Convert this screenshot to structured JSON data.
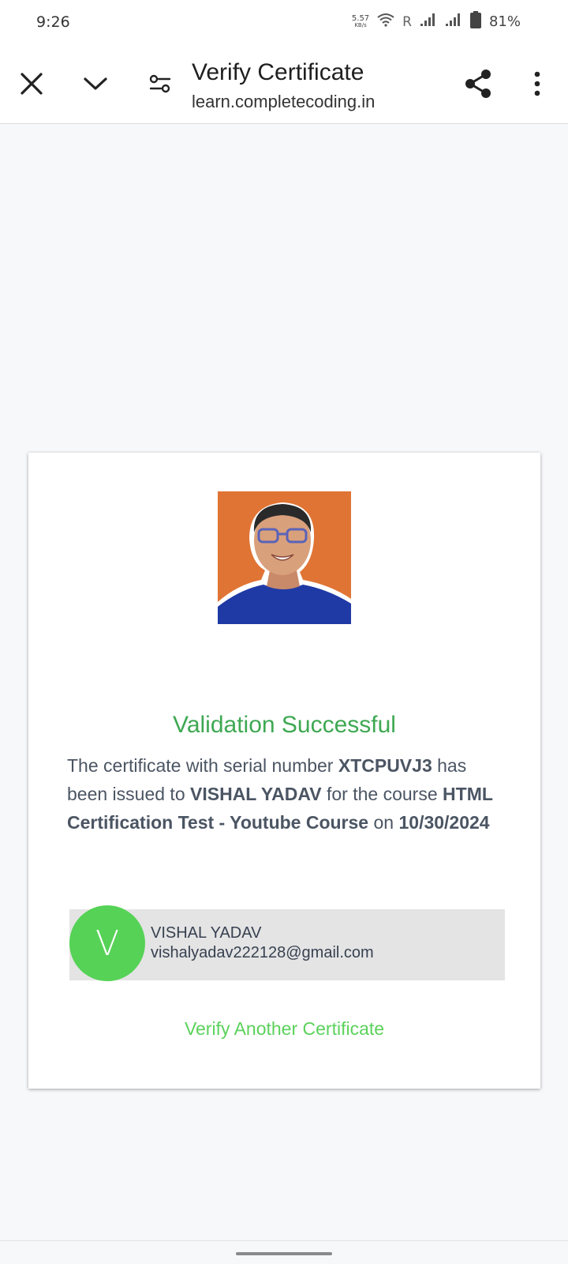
{
  "status_bar": {
    "time": "9:26",
    "net_speed_value": "5.57",
    "net_speed_unit": "KB/s",
    "roaming": "R",
    "battery_percent": "81%"
  },
  "toolbar": {
    "title": "Verify Certificate",
    "url": "learn.completecoding.in",
    "icons": [
      "close-icon",
      "chevron-down-icon",
      "tune-icon",
      "share-icon",
      "more-vert-icon"
    ]
  },
  "card": {
    "validation_title": "Validation Successful",
    "description": {
      "part1": "The certificate with serial number ",
      "serial": "XTCPUVJ3",
      "part2": " has been issued to ",
      "name": "VISHAL YADAV",
      "part3": " for the course ",
      "course": "HTML Certification Test - Youtube Course",
      "part4": " on ",
      "date": "10/30/2024"
    },
    "user": {
      "initial": "V",
      "name": "VISHAL YADAV",
      "email": "vishalyadav222128@gmail.com"
    },
    "verify_another": "Verify Another Certificate"
  },
  "colors": {
    "success_green": "#3ea852",
    "link_green": "#5bd25b",
    "avatar_green": "#56d256",
    "photo_bg": "#e07434",
    "page_bg": "#f7f8fa"
  }
}
